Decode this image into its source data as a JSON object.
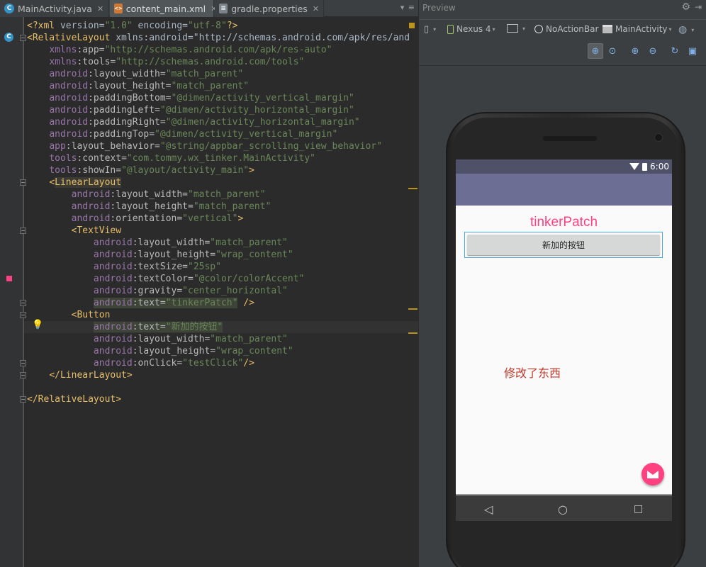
{
  "tabs": [
    {
      "label": "MainActivity.java",
      "icon": "java-class-icon",
      "color": "#3592c4",
      "letter": "C"
    },
    {
      "label": "content_main.xml",
      "icon": "layout-xml-icon",
      "color": "#cc7832",
      "letter": "<>"
    },
    {
      "label": "gradle.properties",
      "icon": "properties-file-icon",
      "color": "#9aa4ad",
      "letter": "≡"
    }
  ],
  "tab_overflow": "▾ ≡",
  "code_lines": [
    "<?xml version=\"1.0\" encoding=\"utf-8\"?>",
    "<RelativeLayout xmlns:android=\"http://schemas.android.com/apk/res/and",
    "    xmlns:app=\"http://schemas.android.com/apk/res-auto\"",
    "    xmlns:tools=\"http://schemas.android.com/tools\"",
    "    android:layout_width=\"match_parent\"",
    "    android:layout_height=\"match_parent\"",
    "    android:paddingBottom=\"@dimen/activity_vertical_margin\"",
    "    android:paddingLeft=\"@dimen/activity_horizontal_margin\"",
    "    android:paddingRight=\"@dimen/activity_horizontal_margin\"",
    "    android:paddingTop=\"@dimen/activity_vertical_margin\"",
    "    app:layout_behavior=\"@string/appbar_scrolling_view_behavior\"",
    "    tools:context=\"com.tommy.wx_tinker.MainActivity\"",
    "    tools:showIn=\"@layout/activity_main\">",
    "    <LinearLayout",
    "        android:layout_width=\"match_parent\"",
    "        android:layout_height=\"match_parent\"",
    "        android:orientation=\"vertical\">",
    "        <TextView",
    "            android:layout_width=\"match_parent\"",
    "            android:layout_height=\"wrap_content\"",
    "            android:textSize=\"25sp\"",
    "            android:textColor=\"@color/colorAccent\"",
    "            android:gravity=\"center_horizontal\"",
    "            android:text=\"tinkerPatch\" />",
    "        <Button",
    "            android:text=\"新加的按钮\"",
    "            android:layout_width=\"match_parent\"",
    "            android:layout_height=\"wrap_content\"",
    "            android:onClick=\"testClick\"/>",
    "    </LinearLayout>",
    "",
    "</RelativeLayout>"
  ],
  "preview": {
    "title": "Preview",
    "toolbar": {
      "device": "Nexus 4",
      "theme": "NoActionBar",
      "activity": "MainActivity"
    }
  },
  "app": {
    "status_time": "6:00",
    "title_text": "tinkerPatch",
    "button_label": "新加的按钮",
    "changed_text": "修改了东西",
    "colors": {
      "accent": "#ff4081",
      "primary": "#6c6f93",
      "primary_dark": "#4f5169",
      "changed_text": "#c0392b"
    }
  }
}
